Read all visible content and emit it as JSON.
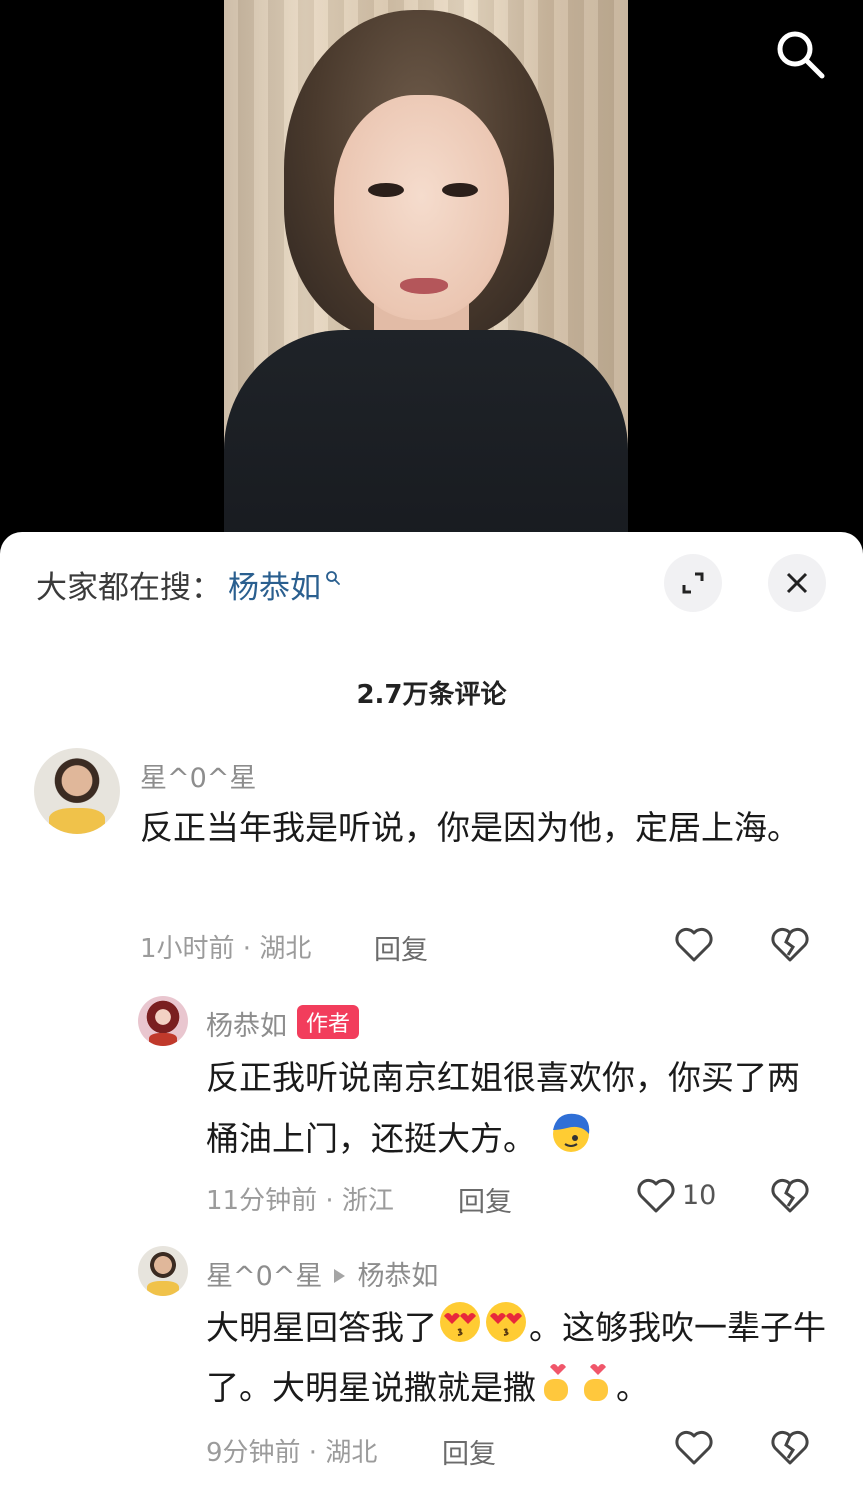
{
  "hot_search": {
    "prefix": "大家都在搜：",
    "keyword": "杨恭如"
  },
  "comment_count": "2.7万条评论",
  "comments": [
    {
      "user": "星^0^星",
      "text": "反正当年我是听说，你是因为他，定居上海。",
      "time_location": "1小时前 · 湖北",
      "reply_label": "回复"
    },
    {
      "user": "杨恭如",
      "badge": "作者",
      "text_part1": "反正我听说南京红姐很喜欢你，你买了两桶油上门，还挺大方。",
      "time_location": "11分钟前 · 浙江",
      "reply_label": "回复",
      "likes": "10"
    },
    {
      "user": "星^0^星",
      "reply_to": "杨恭如",
      "text_part1": "大明星回答我了",
      "text_part2": "。这够我吹一辈子牛了。大明星说撒就是撒",
      "text_part3": "。",
      "time_location": "9分钟前 · 湖北",
      "reply_label": "回复"
    }
  ],
  "icons": [
    "search-icon",
    "expand-icon",
    "close-icon",
    "search-mini-icon",
    "heart-icon",
    "broken-heart-icon",
    "heart-eyes-emoji",
    "finger-heart-emoji",
    "blue-hair-emoji"
  ],
  "colors": {
    "keyword": "#2a5f8f",
    "badge": "#f23d5c",
    "text": "#1a1a1a",
    "meta": "#9b9b9b"
  }
}
